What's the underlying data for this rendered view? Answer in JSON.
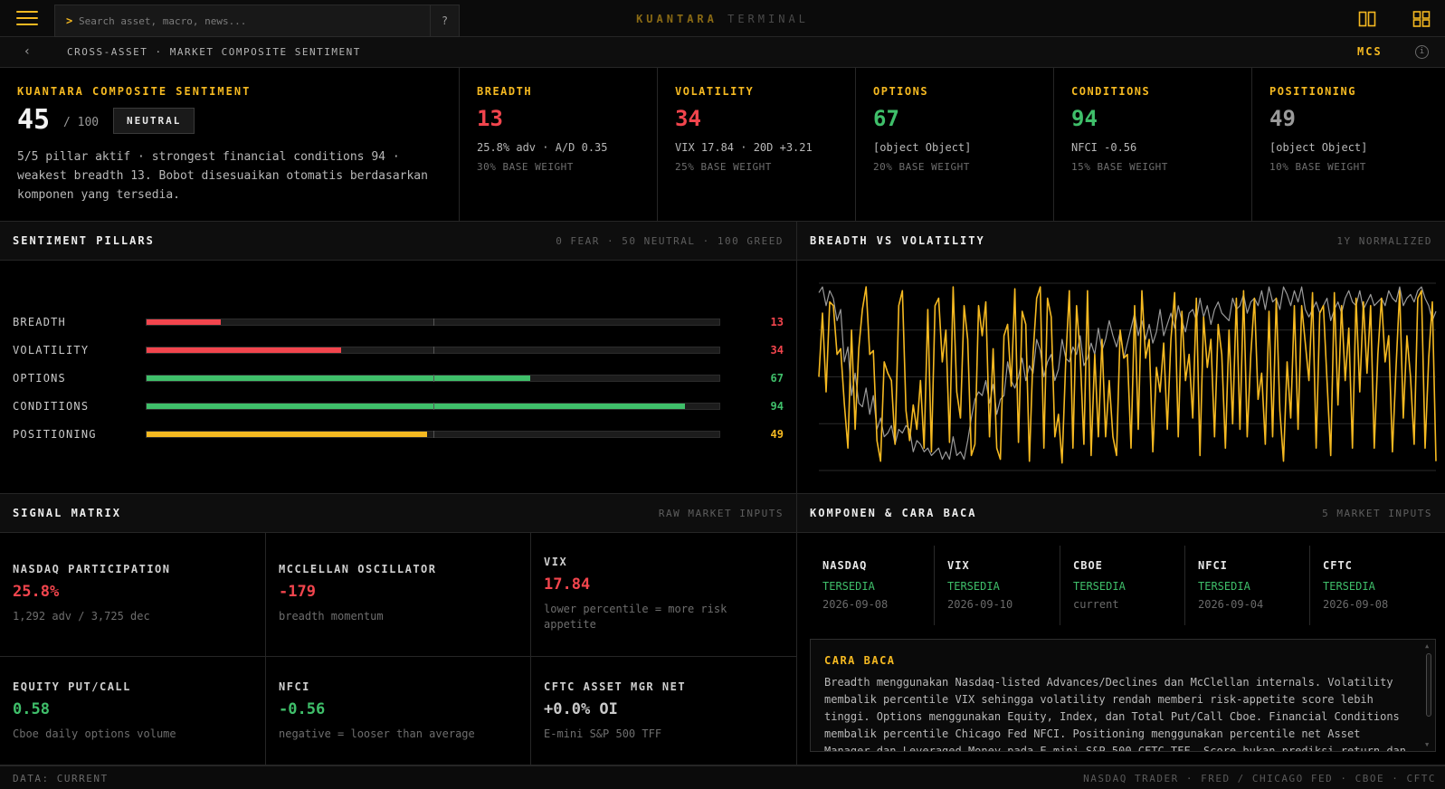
{
  "topbar": {
    "search_prompt": ">",
    "search_placeholder": "Search asset, macro, news...",
    "help_label": "?",
    "brand_primary": "KUANTARA",
    "brand_secondary": "TERMINAL",
    "accent_color": "#f5b921",
    "icons": [
      "menu-icon",
      "split-view-icon",
      "grid-view-icon"
    ]
  },
  "subbar": {
    "back_symbol": "‹",
    "breadcrumb": "CROSS-ASSET · MARKET COMPOSITE SENTIMENT",
    "code": "MCS",
    "info_symbol": "i"
  },
  "composite": {
    "title": "KUANTARA COMPOSITE SENTIMENT",
    "score": "45",
    "max": "/ 100",
    "badge": "NEUTRAL",
    "description": "5/5 pillar aktif · strongest financial conditions 94 · weakest breadth 13. Bobot disesuaikan otomatis berdasarkan komponen yang tersedia."
  },
  "pillars": [
    {
      "title": "BREADTH",
      "score": "13",
      "color": "#f2454d",
      "detail": "25.8% adv · A/D 0.35",
      "weight": "30% BASE WEIGHT"
    },
    {
      "title": "VOLATILITY",
      "score": "34",
      "color": "#f2454d",
      "detail": "VIX 17.84 · 20D +3.21",
      "weight": "25% BASE WEIGHT"
    },
    {
      "title": "OPTIONS",
      "score": "67",
      "color": "#3fbf6a",
      "detail": "[object Object]",
      "weight": "20% BASE WEIGHT"
    },
    {
      "title": "CONDITIONS",
      "score": "94",
      "color": "#3fbf6a",
      "detail": "NFCI -0.56",
      "weight": "15% BASE WEIGHT"
    },
    {
      "title": "POSITIONING",
      "score": "49",
      "color": "#9a9a9a",
      "detail": "[object Object]",
      "weight": "10% BASE WEIGHT"
    }
  ],
  "sentiment_panel": {
    "title": "SENTIMENT PILLARS",
    "scale": "0 FEAR · 50 NEUTRAL · 100 GREED",
    "bars": [
      {
        "label": "BREADTH",
        "value": 13,
        "display": "13",
        "color": "#f2454d"
      },
      {
        "label": "VOLATILITY",
        "value": 34,
        "display": "34",
        "color": "#f2454d"
      },
      {
        "label": "OPTIONS",
        "value": 67,
        "display": "67",
        "color": "#3fbf6a"
      },
      {
        "label": "CONDITIONS",
        "value": 94,
        "display": "94",
        "color": "#3fbf6a"
      },
      {
        "label": "POSITIONING",
        "value": 49,
        "display": "49",
        "color": "#f5b921"
      }
    ]
  },
  "chart_panel": {
    "title": "BREADTH VS VOLATILITY",
    "subtitle": "1Y NORMALIZED"
  },
  "chart_data": {
    "type": "line",
    "title": "BREADTH VS VOLATILITY",
    "subtitle": "1Y NORMALIZED",
    "ylim": [
      0,
      100
    ],
    "grid": true,
    "series": [
      {
        "color": "#f5b921",
        "values": [
          50,
          84,
          42,
          90,
          88,
          62,
          65,
          36,
          12,
          75,
          22,
          65,
          86,
          98,
          62,
          64,
          16,
          5,
          58,
          52,
          48,
          14,
          88,
          96,
          32,
          16,
          35,
          22,
          48,
          12,
          86,
          10,
          88,
          92,
          58,
          75,
          15,
          98,
          42,
          28,
          88,
          70,
          8,
          14,
          88,
          72,
          90,
          18,
          65,
          12,
          6,
          72,
          78,
          45,
          97,
          15,
          85,
          78,
          5,
          62,
          92,
          98,
          12,
          92,
          82,
          18,
          30,
          4,
          58,
          96,
          12,
          88,
          62,
          14,
          96,
          8,
          62,
          18,
          70,
          18,
          48,
          18,
          8,
          75,
          60,
          62,
          12,
          88,
          22,
          96,
          60,
          70,
          10,
          55,
          42,
          68,
          22,
          70,
          95,
          18,
          85,
          48,
          62,
          28,
          92,
          8,
          82,
          55,
          70,
          18,
          78,
          62,
          12,
          75,
          25,
          92,
          22,
          96,
          18,
          62,
          92,
          38,
          52,
          14,
          85,
          18,
          92,
          32,
          5,
          58,
          28,
          88,
          22,
          88,
          68,
          48,
          95,
          12,
          84,
          88,
          48,
          8,
          95,
          35,
          88,
          48,
          76,
          12,
          92,
          42,
          90,
          52,
          88,
          12,
          62,
          92,
          58,
          72,
          10,
          55,
          96,
          28,
          72,
          50,
          14,
          92,
          96,
          12,
          60,
          90,
          5
        ]
      },
      {
        "color": "#9a9a9a",
        "values": [
          95,
          98,
          88,
          96,
          92,
          80,
          86,
          58,
          66,
          40,
          52,
          36,
          34,
          44,
          30,
          40,
          22,
          28,
          18,
          20,
          24,
          14,
          22,
          20,
          24,
          22,
          10,
          16,
          14,
          10,
          12,
          8,
          10,
          12,
          6,
          10,
          6,
          18,
          8,
          10,
          6,
          16,
          28,
          38,
          42,
          40,
          48,
          36,
          46,
          30,
          38,
          40,
          58,
          48,
          44,
          50,
          60,
          48,
          56,
          52,
          70,
          64,
          50,
          58,
          62,
          48,
          54,
          70,
          60,
          58,
          66,
          62,
          72,
          56,
          60,
          68,
          62,
          76,
          64,
          70,
          80,
          72,
          66,
          74,
          60,
          68,
          76,
          84,
          72,
          80,
          70,
          78,
          68,
          74,
          86,
          72,
          78,
          84,
          76,
          88,
          80,
          74,
          84,
          86,
          80,
          92,
          82,
          88,
          78,
          86,
          90,
          84,
          82,
          80,
          92,
          86,
          88,
          94,
          84,
          90,
          92,
          88,
          96,
          86,
          98,
          90,
          92,
          86,
          98,
          94,
          88,
          96,
          90,
          98,
          86,
          82,
          86,
          90,
          84,
          88,
          92,
          80,
          86,
          90,
          84,
          92,
          96,
          90,
          88,
          96,
          86,
          90,
          94,
          88,
          90,
          92,
          88,
          96,
          92,
          90,
          98,
          88,
          92,
          94,
          90,
          96,
          98,
          92,
          88,
          80,
          85
        ]
      }
    ]
  },
  "matrix": {
    "title": "SIGNAL MATRIX",
    "subtitle": "RAW MARKET INPUTS",
    "cells": [
      {
        "title": "NASDAQ PARTICIPATION",
        "value": "25.8%",
        "color": "#f2454d",
        "sub": "1,292 adv / 3,725 dec"
      },
      {
        "title": "MCCLELLAN OSCILLATOR",
        "value": "-179",
        "color": "#f2454d",
        "sub": "breadth momentum"
      },
      {
        "title": "VIX",
        "value": "17.84",
        "color": "#f2454d",
        "sub": "lower percentile = more risk appetite"
      },
      {
        "title": "EQUITY PUT/CALL",
        "value": "0.58",
        "color": "#3fbf6a",
        "sub": "Cboe daily options volume"
      },
      {
        "title": "NFCI",
        "value": "-0.56",
        "color": "#3fbf6a",
        "sub": "negative = looser than average"
      },
      {
        "title": "CFTC ASSET MGR NET",
        "value": "+0.0% OI",
        "color": "#c9c9c9",
        "sub": "E-mini S&P 500 TFF"
      }
    ]
  },
  "components": {
    "title": "KOMPONEN & CARA BACA",
    "subtitle": "5 MARKET INPUTS",
    "items": [
      {
        "name": "NASDAQ",
        "status": "TERSEDIA",
        "date": "2026-09-08"
      },
      {
        "name": "VIX",
        "status": "TERSEDIA",
        "date": "2026-09-10"
      },
      {
        "name": "CBOE",
        "status": "TERSEDIA",
        "date": "current"
      },
      {
        "name": "NFCI",
        "status": "TERSEDIA",
        "date": "2026-09-04"
      },
      {
        "name": "CFTC",
        "status": "TERSEDIA",
        "date": "2026-09-08"
      }
    ],
    "howto_title": "CARA BACA",
    "howto_body": "Breadth menggunakan Nasdaq-listed Advances/Declines dan McClellan internals. Volatility membalik percentile VIX sehingga volatility rendah memberi risk-appetite score lebih tinggi. Options menggunakan Equity, Index, dan Total Put/Call Cboe. Financial Conditions membalik percentile Chicago Fed NFCI. Positioning menggunakan percentile net Asset Manager dan Leveraged Money pada E-mini S&P 500 CFTC TFF. Score bukan prediksi return dan ekstrem"
  },
  "footer": {
    "left": "DATA: CURRENT",
    "right": "NASDAQ TRADER · FRED / CHICAGO FED · CBOE · CFTC"
  }
}
